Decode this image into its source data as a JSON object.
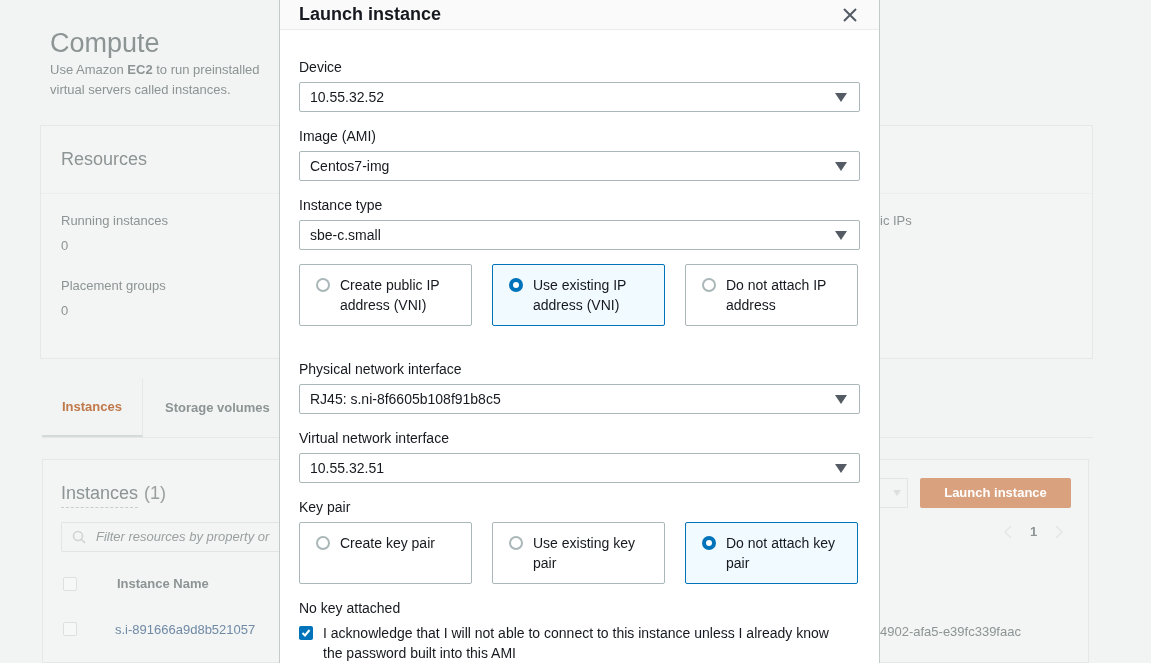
{
  "page": {
    "title": "Compute",
    "description_lines": [
      "Use Amazon **EC2** to run preinstalled",
      "virtual servers called instances."
    ]
  },
  "resources": {
    "title": "Resources",
    "stats": [
      {
        "label": "Running instances",
        "value": "0"
      },
      {
        "label": "Placement groups",
        "value": "0"
      }
    ],
    "cut_label": "ic IPs"
  },
  "tabs": [
    {
      "label": "Instances",
      "selected": true
    },
    {
      "label": "Storage volumes",
      "selected": false
    }
  ],
  "instances_panel": {
    "title": "Instances",
    "count": "(1)",
    "search": {
      "placeholder": "Filter resources by property or"
    },
    "launch_button": "Launch instance",
    "pagination": {
      "page": "1"
    },
    "header_checked": false,
    "columns": [
      "Instance Name"
    ],
    "rows": [
      {
        "selected": false,
        "name": "s.i-891666a9d8b521057",
        "column_2": "4902-afa5-e39fc339faac"
      }
    ]
  },
  "modal": {
    "title": "Launch instance",
    "fields": [
      {
        "kind": "select",
        "label": "Device",
        "value": "10.55.32.52"
      },
      {
        "kind": "select",
        "label": "Image (AMI)",
        "value": "Centos7-img"
      },
      {
        "kind": "select",
        "label": "Instance type",
        "value": "sbe-c.small"
      },
      {
        "kind": "radio-group",
        "options": [
          {
            "label": "Create public IP address (VNI)",
            "selected": false
          },
          {
            "label": "Use existing IP address (VNI)",
            "selected": true
          },
          {
            "label": "Do not attach IP address",
            "selected": false
          }
        ]
      },
      {
        "kind": "select",
        "label": "Physical network interface",
        "value": "RJ45: s.ni-8f6605b108f91b8c5"
      },
      {
        "kind": "select",
        "label": "Virtual network interface",
        "value": "10.55.32.51"
      },
      {
        "kind": "radio-group",
        "label": "Key pair",
        "options": [
          {
            "label": "Create key pair",
            "selected": false
          },
          {
            "label": "Use existing key pair",
            "selected": false
          },
          {
            "label": "Do not attach key pair",
            "selected": true
          }
        ]
      },
      {
        "kind": "note",
        "text": "No key attached"
      },
      {
        "kind": "checkbox",
        "label": "I acknowledge that I will not able to connect to this instance unless I already know the password built into this AMI",
        "checked": true
      }
    ]
  }
}
